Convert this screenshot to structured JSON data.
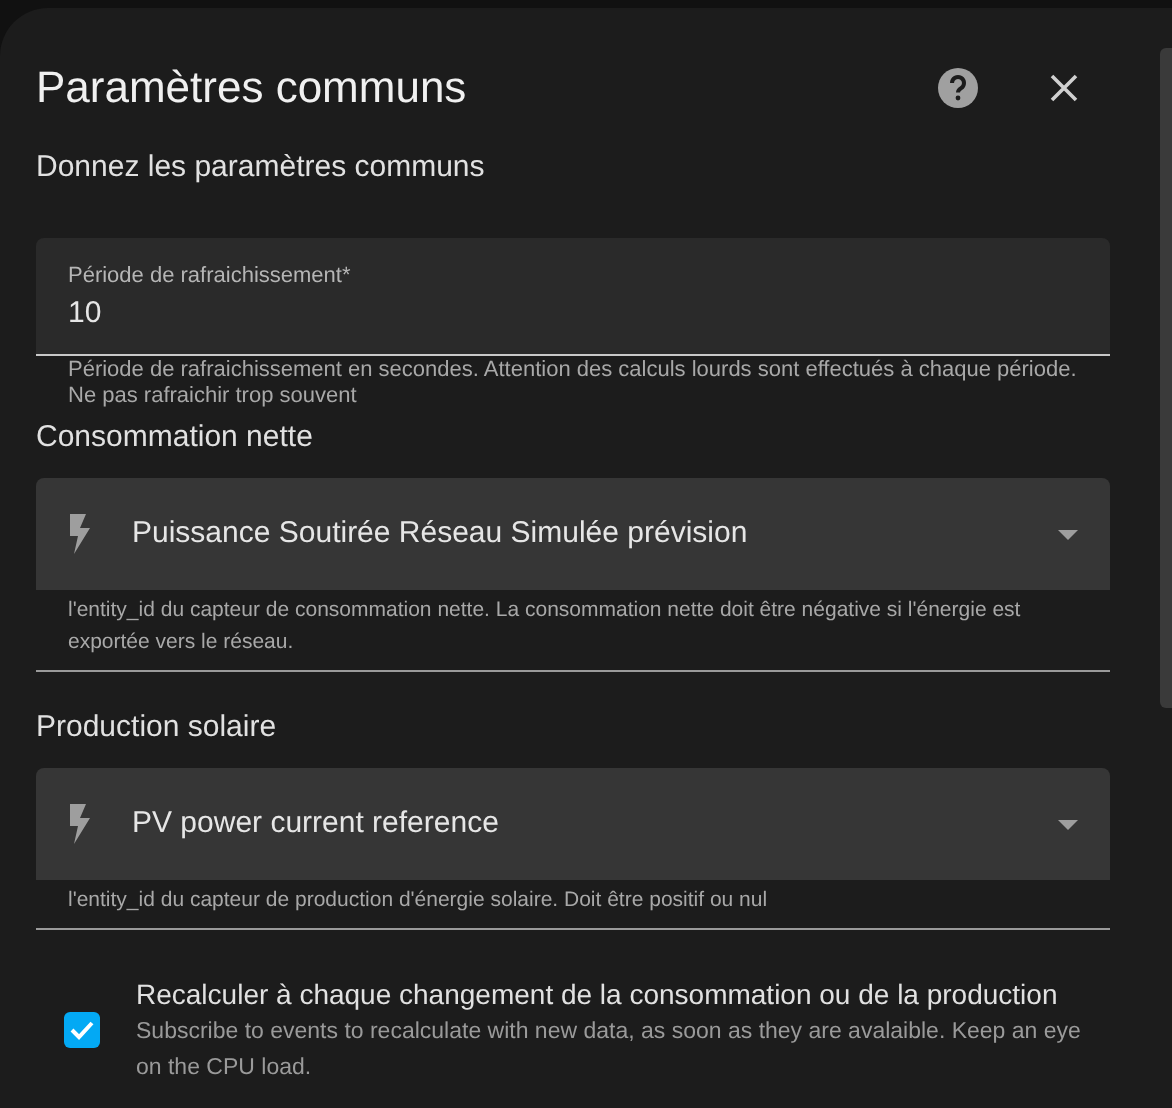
{
  "dialog": {
    "title": "Paramètres communs",
    "subtitle": "Donnez les paramètres communs"
  },
  "fields": [
    {
      "kind": "text",
      "label": "Période de rafraichissement*",
      "value": "10",
      "helper": "Période de rafraichissement en secondes. Attention des calculs lourds sont effectués à chaque période. Ne pas rafraichir trop souvent"
    },
    {
      "kind": "select",
      "heading": "Consommation nette",
      "value": "Puissance Soutirée Réseau Simulée prévision",
      "helper": "l'entity_id du capteur de consommation nette. La consommation nette doit être négative si l'énergie est exportée vers le réseau."
    },
    {
      "kind": "select",
      "heading": "Production solaire",
      "value": "PV power current reference",
      "helper": "l'entity_id du capteur de production d'énergie solaire. Doit être positif ou nul"
    }
  ],
  "option": {
    "checked": true,
    "label": "Recalculer à chaque changement de la consommation ou de la production",
    "description": "Subscribe to events to recalculate with new data, as soon as they are avalaible. Keep an eye on the CPU load."
  }
}
